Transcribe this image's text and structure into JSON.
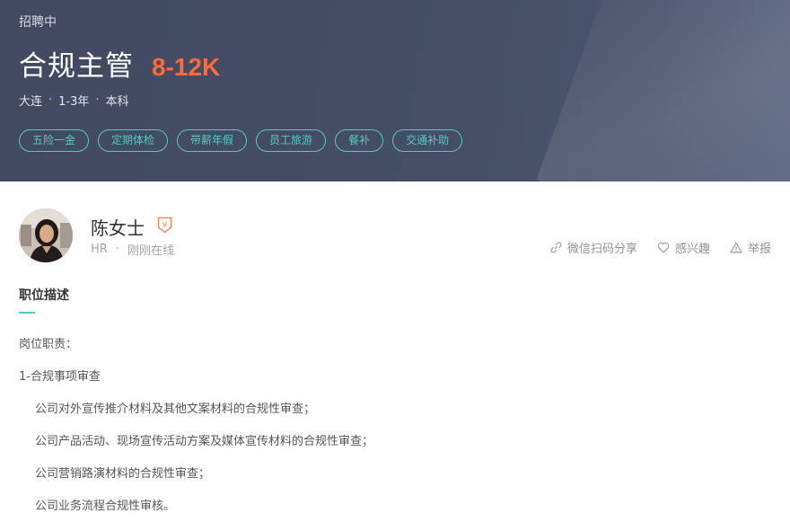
{
  "header": {
    "status": "招聘中",
    "job_title": "合规主管",
    "salary": "8-12K",
    "city": "大连",
    "experience": "1-3年",
    "education": "本科",
    "meta_separator": "·",
    "tags": [
      "五险一金",
      "定期体检",
      "带薪年假",
      "员工旅游",
      "餐补",
      "交通补助"
    ]
  },
  "recruiter": {
    "name": "陈女士",
    "badge_letter": "V",
    "role": "HR",
    "separator": "·",
    "online_status": "刚刚在线"
  },
  "actions": {
    "share_label": "微信扫码分享",
    "favorite_label": "感兴趣",
    "report_label": "举报"
  },
  "description": {
    "section_title": "职位描述",
    "lines": [
      "岗位职责：",
      "1-合规事项审查",
      "公司对外宣传推介材料及其他文案材料的合规性审查；",
      "公司产品活动、现场宣传活动方案及媒体宣传材料的合规性审查；",
      "公司营销路演材料的合规性审查；",
      "公司业务流程合规性审核。"
    ]
  },
  "colors": {
    "banner": "#414a60",
    "accent_teal": "#53cac3",
    "salary": "#ff6a3d"
  }
}
